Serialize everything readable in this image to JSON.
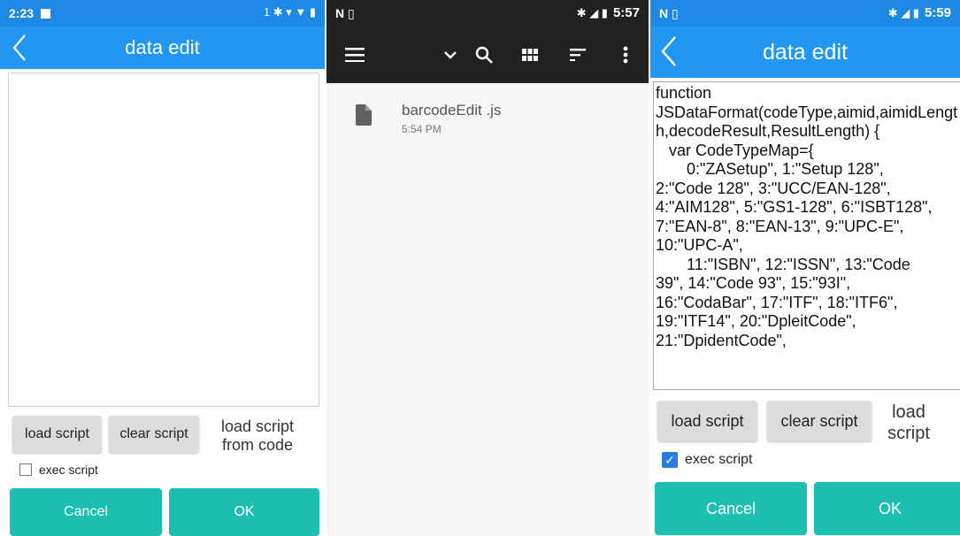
{
  "panel1": {
    "status": {
      "time": "2:23",
      "right_icons": "1 ✱ ▾ ▼ ▮"
    },
    "title": "data edit",
    "editor_text": "",
    "load_button": "load script",
    "clear_button": "clear script",
    "side_note": "load script from code",
    "exec_label": "exec script",
    "exec_checked": false,
    "cancel_button": "Cancel",
    "ok_button": "OK"
  },
  "panel2": {
    "status": {
      "left_icons": "N ▯",
      "time": "5:57",
      "right_icons": "✱ ◢ ▮"
    },
    "file": {
      "name": "barcodeEdit .js",
      "time": "5:54 PM"
    }
  },
  "panel3": {
    "status": {
      "left_icons": "N ▯",
      "time": "5:59",
      "right_icons": "✱ ◢ ▮"
    },
    "title": "data edit",
    "editor_text": "function\nJSDataFormat(codeType,aimid,aimidLength,decodeResult,ResultLength) {\n   var CodeTypeMap={\n       0:\"ZASetup\", 1:\"Setup 128\",\n2:\"Code 128\", 3:\"UCC/EAN-128\",\n4:\"AIM128\", 5:\"GS1-128\", 6:\"ISBT128\",\n7:\"EAN-8\", 8:\"EAN-13\", 9:\"UPC-E\",\n10:\"UPC-A\",\n       11:\"ISBN\", 12:\"ISSN\", 13:\"Code\n39\", 14:\"Code 93\", 15:\"93I\",\n16:\"CodaBar\", 17:\"ITF\", 18:\"ITF6\",\n19:\"ITF14\", 20:\"DpleitCode\",\n21:\"DpidentCode\",",
    "load_button": "load script",
    "clear_button": "clear script",
    "side_note": "load script",
    "exec_label": "exec script",
    "exec_checked": true,
    "cancel_button": "Cancel",
    "ok_button": "OK"
  },
  "colors": {
    "status_bar": "#1e88e5",
    "app_bar": "#2196f3",
    "teal_button": "#1cbfb1",
    "file_manager_toolbar": "#212121"
  },
  "icons": [
    "back-arrow-icon",
    "menu-icon",
    "chevron-down-icon",
    "search-icon",
    "grid-view-icon",
    "sort-icon",
    "more-vert-icon",
    "document-icon",
    "checkbox-icon",
    "bluetooth-icon",
    "battery-icon",
    "signal-icon"
  ]
}
